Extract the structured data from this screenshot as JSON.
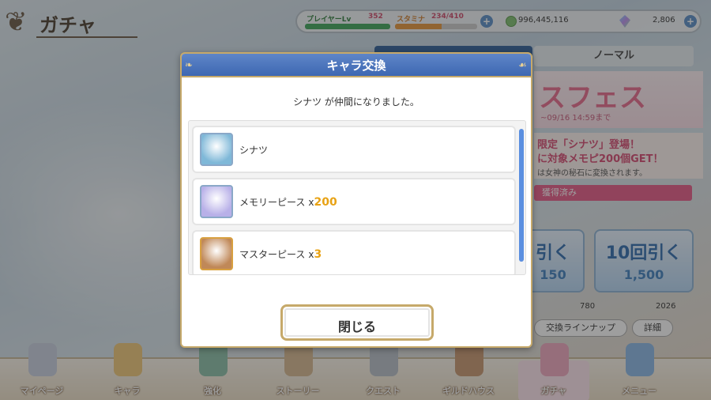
{
  "screen": {
    "title": "ガチャ",
    "player_level_label": "プレイヤーLv",
    "player_level": "352",
    "stamina_label": "スタミナ",
    "stamina_value": "234/410",
    "stamina_fraction": 0.57,
    "mana": "996,445,116",
    "jewels": "2,806",
    "tab_normal": "ノーマル",
    "banner": {
      "logo": "スフェス",
      "date": "~09/16 14:59まで",
      "line1": "限定「シナツ」登場！",
      "line2": "に対象メモピ200個GET！",
      "note": "は女神の秘石に変換されます。",
      "owned": "獲得済み"
    },
    "pull1": {
      "label": "引く",
      "cost": "150"
    },
    "pull10": {
      "label": "10回引く",
      "cost": "1,500"
    },
    "info_left": "780",
    "info_right": "2026",
    "lineup_button": "交換ラインナップ",
    "details_button": "詳細"
  },
  "nav": [
    {
      "label": "マイページ",
      "color": "#c8cfe0"
    },
    {
      "label": "キャラ",
      "color": "#f0c878"
    },
    {
      "label": "強化",
      "color": "#8ac0a8"
    },
    {
      "label": "ストーリー",
      "color": "#d8b890"
    },
    {
      "label": "クエスト",
      "color": "#b8c0c8"
    },
    {
      "label": "ギルドハウス",
      "color": "#c89870"
    },
    {
      "label": "ガチャ",
      "color": "#f0a8c0"
    },
    {
      "label": "メニュー",
      "color": "#8ab8e8"
    }
  ],
  "modal": {
    "title": "キャラ交換",
    "message_name": "シナツ",
    "message_rest": "が仲間になりました。",
    "rewards": [
      {
        "name": "シナツ",
        "multiplier": "",
        "qty": "",
        "icon": "character-icon",
        "color": "#7fb8d8"
      },
      {
        "name": "メモリーピース",
        "multiplier": "x",
        "qty": "200",
        "icon": "memory-piece-icon",
        "color": "#b8b0e8"
      },
      {
        "name": "マスターピース",
        "multiplier": "x",
        "qty": "3",
        "icon": "master-piece-icon",
        "color": "#c08858"
      }
    ],
    "close_label": "閉じる"
  }
}
